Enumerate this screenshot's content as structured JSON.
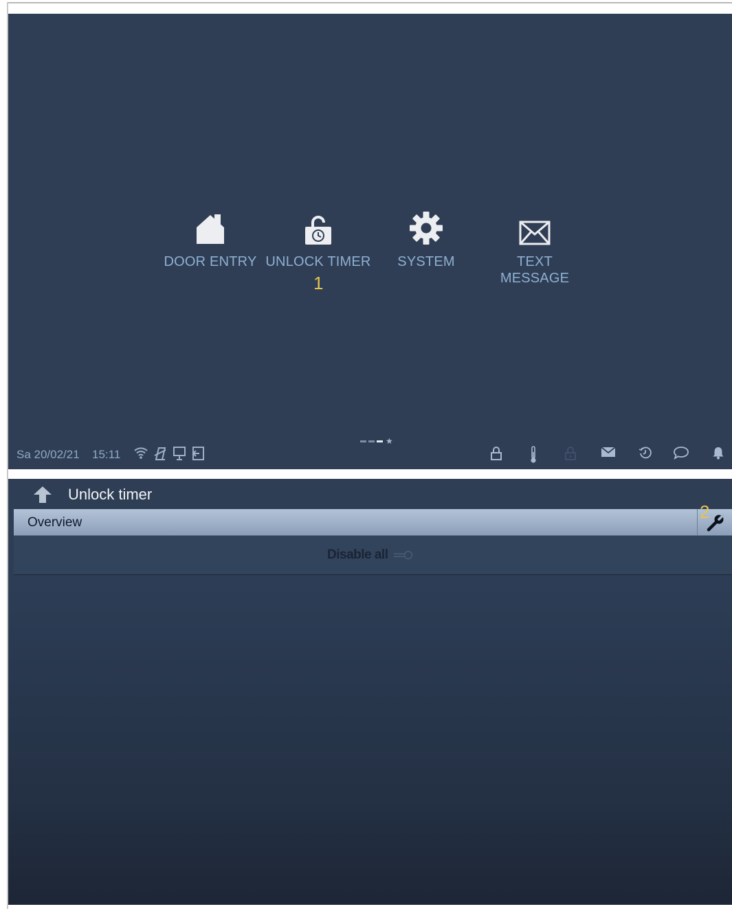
{
  "colors": {
    "background": "#2f3e55",
    "label": "#8fb0d2",
    "callout": "#e7c44a",
    "tab_bar": "#a5b6cc"
  },
  "home": {
    "apps": [
      {
        "label": "DOOR ENTRY",
        "icon": "house-icon"
      },
      {
        "label": "UNLOCK TIMER",
        "icon": "unlock-timer-icon"
      },
      {
        "label": "SYSTEM",
        "icon": "gear-icon"
      },
      {
        "label": "TEXT\nMESSAGE",
        "icon": "envelope-icon"
      }
    ],
    "callout": "1",
    "status_bar": {
      "date": "Sa 20/02/21",
      "time": "15:11",
      "left_icons": [
        "wifi-icon",
        "mute-icon",
        "monitor-icon",
        "exit-icon"
      ],
      "right_icons": [
        "lock-icon",
        "thermometer-icon",
        "locked-padlock-icon",
        "mail-icon",
        "history-icon",
        "chat-icon",
        "bell-icon"
      ],
      "pager": {
        "pages": 3,
        "active": 3,
        "has_favorite": true
      }
    }
  },
  "unlock_timer_screen": {
    "title": "Unlock timer",
    "tab": "Overview",
    "callout": "2",
    "disable_all": "Disable all",
    "disable_all_state": "off"
  }
}
